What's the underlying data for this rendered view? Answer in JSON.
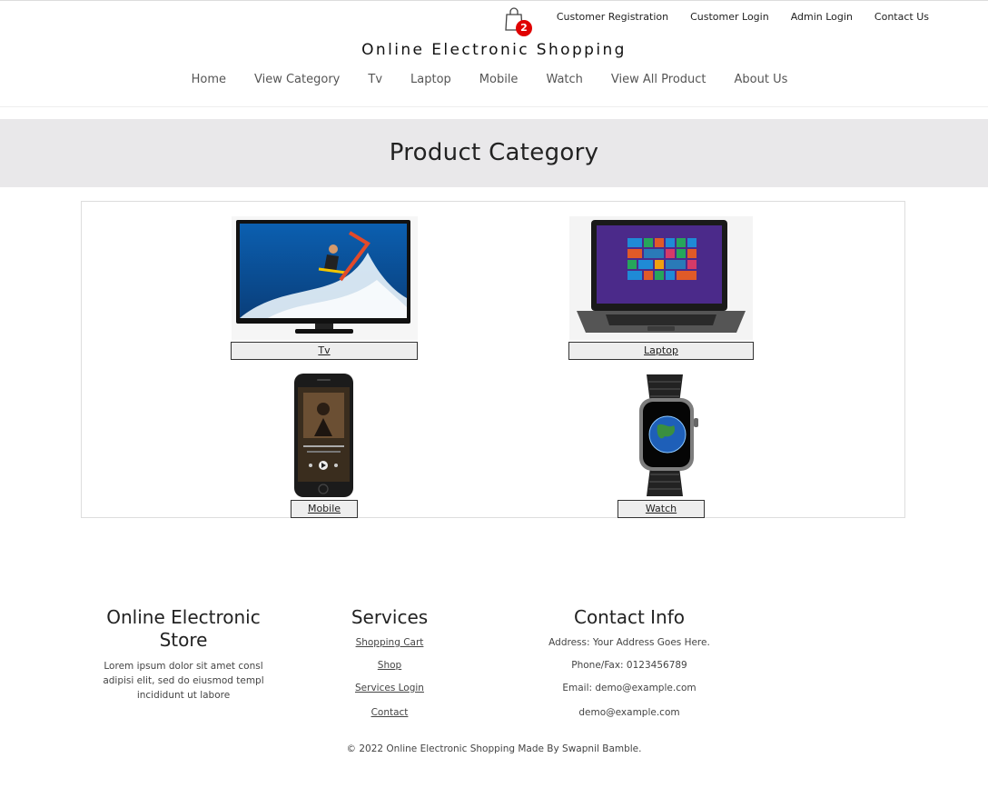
{
  "header": {
    "cart_count": "2",
    "top_links": [
      "Customer Registration",
      "Customer Login",
      "Admin Login",
      "Contact Us"
    ],
    "brand": "Online Electronic Shopping",
    "nav": [
      "Home",
      "View Category",
      "Tv",
      "Laptop",
      "Mobile",
      "Watch",
      "View All Product",
      "About Us"
    ]
  },
  "banner": {
    "title": "Product Category"
  },
  "categories": [
    {
      "label": "Tv"
    },
    {
      "label": "Laptop"
    },
    {
      "label": "Mobile"
    },
    {
      "label": "Watch"
    }
  ],
  "footer": {
    "store": {
      "title": "Online Electronic Store",
      "text": "Lorem ipsum dolor sit amet consl adipisi elit, sed do eiusmod templ incididunt ut labore"
    },
    "services": {
      "title": "Services",
      "links": [
        "Shopping Cart",
        "Shop",
        "Services Login",
        "Contact"
      ]
    },
    "contact": {
      "title": "Contact Info",
      "lines": [
        "Address: Your Address Goes Here.",
        "Phone/Fax: 0123456789",
        "Email: demo@example.com",
        "demo@example.com"
      ]
    },
    "copyright": "© 2022 Online Electronic Shopping Made By Swapnil Bamble."
  },
  "colors": {
    "badge": "#e00000",
    "banner_bg": "#e9e8ea"
  }
}
